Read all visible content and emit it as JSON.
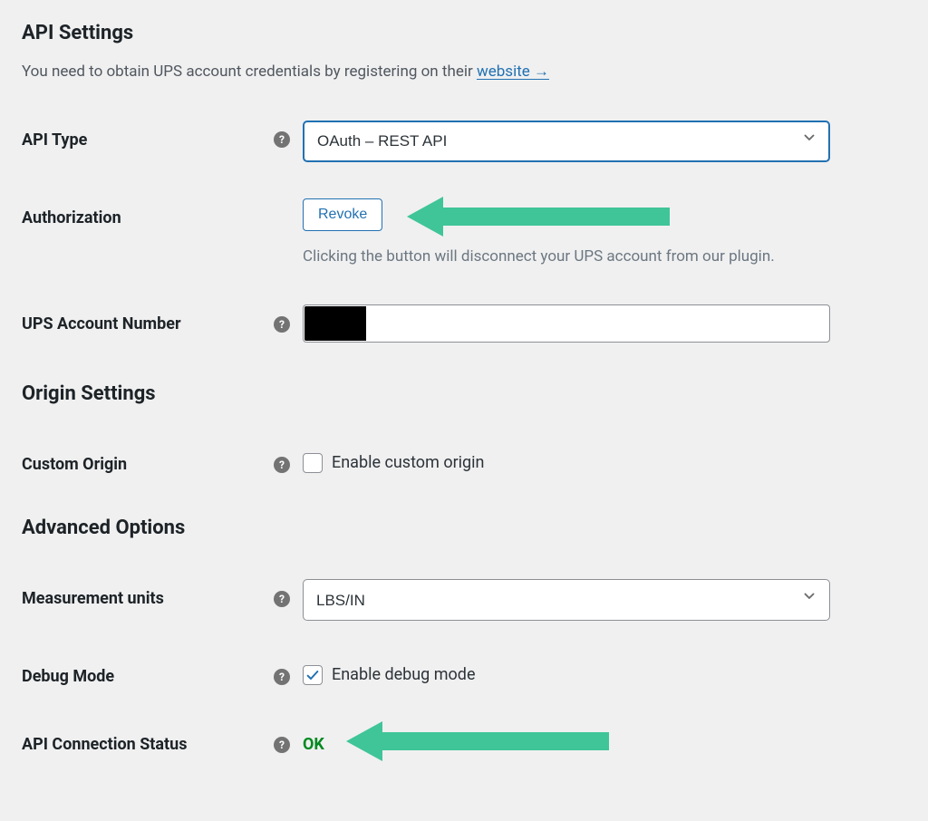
{
  "api_settings": {
    "title": "API Settings",
    "subtitle_prefix": "You need to obtain UPS account credentials by registering on their ",
    "subtitle_link": "website →"
  },
  "fields": {
    "api_type": {
      "label": "API Type",
      "value": "OAuth – REST API"
    },
    "authorization": {
      "label": "Authorization",
      "button": "Revoke",
      "help": "Clicking the button will disconnect your UPS account from our plugin."
    },
    "account_number": {
      "label": "UPS Account Number",
      "value": ""
    },
    "custom_origin": {
      "label": "Custom Origin",
      "checkbox_label": "Enable custom origin",
      "checked": false
    },
    "measurement_units": {
      "label": "Measurement units",
      "value": "LBS/IN"
    },
    "debug_mode": {
      "label": "Debug Mode",
      "checkbox_label": "Enable debug mode",
      "checked": true
    },
    "connection_status": {
      "label": "API Connection Status",
      "value": "OK"
    }
  },
  "origin_settings": {
    "title": "Origin Settings"
  },
  "advanced_options": {
    "title": "Advanced Options"
  },
  "annotation_color": "#3fc598"
}
